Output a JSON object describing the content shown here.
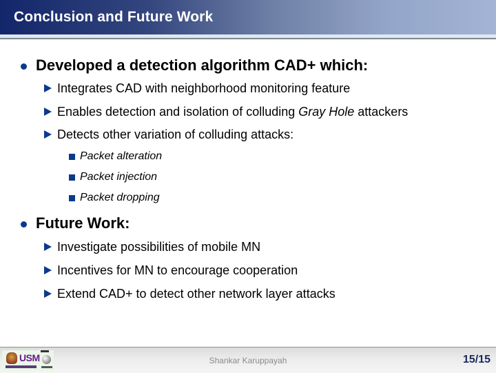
{
  "slide": {
    "title": "Conclusion and Future Work",
    "bullets": [
      {
        "text": "Developed a detection algorithm CAD+ which:",
        "sub": [
          {
            "text": "Integrates CAD with neighborhood monitoring feature"
          },
          {
            "text_before": "Enables detection and isolation of colluding ",
            "text_italic": "Gray Hole",
            "text_after": " attackers"
          },
          {
            "text": "Detects other variation of colluding attacks:",
            "sub": [
              {
                "text": "Packet alteration"
              },
              {
                "text": "Packet injection"
              },
              {
                "text": "Packet dropping"
              }
            ]
          }
        ]
      },
      {
        "text": "Future Work:",
        "sub": [
          {
            "text": "Investigate possibilities of mobile MN"
          },
          {
            "text": "Incentives for MN to encourage cooperation"
          },
          {
            "text": "Extend CAD+ to detect other network layer attacks"
          }
        ]
      }
    ]
  },
  "footer": {
    "logo_text": "USM",
    "author": "Shankar Karuppayah",
    "page": "15/15"
  },
  "colors": {
    "title_bg_start": "#12266a",
    "title_bg_end": "#a3b4d6",
    "bullet_accent": "#0b3a8c",
    "page_number": "#1a2a5a"
  },
  "icons": {
    "level1": "filled-circle-bullet",
    "level2": "right-triangle-bullet",
    "level3": "filled-square-bullet"
  }
}
